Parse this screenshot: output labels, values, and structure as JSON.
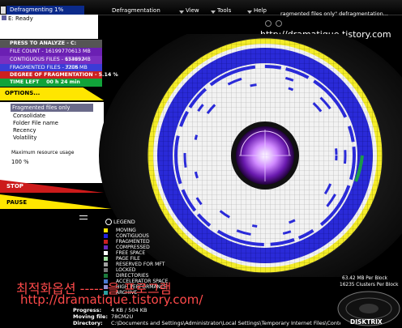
{
  "titlebar": {
    "status": "Defragmenting 1%",
    "menu": [
      "Defragmentation",
      "View",
      "Tools",
      "Help"
    ],
    "tooltip": "ragmented files only\" defragmentation..."
  },
  "watermark": {
    "top": "http://dramatique.tistory.com",
    "korean": "최적화옵션 ----- 을 프로그램",
    "bottom": "http://dramatique.tistory.com/"
  },
  "drive": {
    "label": "E:",
    "status": "Ready"
  },
  "stats": {
    "press": "PRESS TO ANALYZE - C:",
    "file_count": {
      "label": "FILE COUNT -",
      "count": "161997",
      "size": "70613 MB"
    },
    "contiguous": {
      "label": "CONTIGUOUS FILES -",
      "count": "154692",
      "size": "67395 MB"
    },
    "fragmented": {
      "label": "FRAGMENTED FILES -",
      "count": "7305",
      "size": "3218 MB"
    },
    "degree": "DEGREE OF FRAGMENTATION - 5.14 %",
    "time_left": "TIME LEFT",
    "time_value": "00 h 24 min"
  },
  "options": {
    "label": "OPTIONS...",
    "items": [
      "Fragmented files only",
      "Consolidate",
      "Folder File name",
      "Recency",
      "Volatility"
    ],
    "resource_label": "Maximum resource usage",
    "resource_value": "100 %"
  },
  "controls": {
    "stop": "STOP",
    "pause": "PAUSE"
  },
  "legend": {
    "title": "LEGEND",
    "items": [
      {
        "label": "MOVING",
        "color": "#ffe600"
      },
      {
        "label": "CONTIGUOUS",
        "color": "#2222dd"
      },
      {
        "label": "FRAGMENTED",
        "color": "#cc2020"
      },
      {
        "label": "COMPRESSED",
        "color": "#6a2bbd"
      },
      {
        "label": "FREE SPACE",
        "color": "#ffffff"
      },
      {
        "label": "PAGE FILE",
        "color": "#a0e0a0"
      },
      {
        "label": "RESERVED FOR MFT",
        "color": "#a0a0a0"
      },
      {
        "label": "LOCKED",
        "color": "#7a7a7a"
      },
      {
        "label": "DIRECTORIES",
        "color": "#1a7a3a"
      },
      {
        "label": "ACCELERATOR SPACE",
        "color": "#4a7ad0"
      },
      {
        "label": "HIGH PERFORMANCE",
        "color": "#9090d0"
      },
      {
        "label": "ARCHIVE",
        "color": "#2aa0a0"
      }
    ]
  },
  "disk_info": {
    "block": "63.42 MB Per Block",
    "clusters": "16235 Clusters Per Block"
  },
  "bottom": {
    "progress_label": "Progress:",
    "progress_value": "4 KB / 504 KB",
    "moving_label": "Moving file:",
    "moving_value": "78CM2U",
    "directory_label": "Directory:",
    "directory_value": "C:\\Documents and Settings\\Administrator\\Local Settings\\Temporary Internet Files\\Conten"
  },
  "logo": {
    "text": "DISKTRIX"
  }
}
